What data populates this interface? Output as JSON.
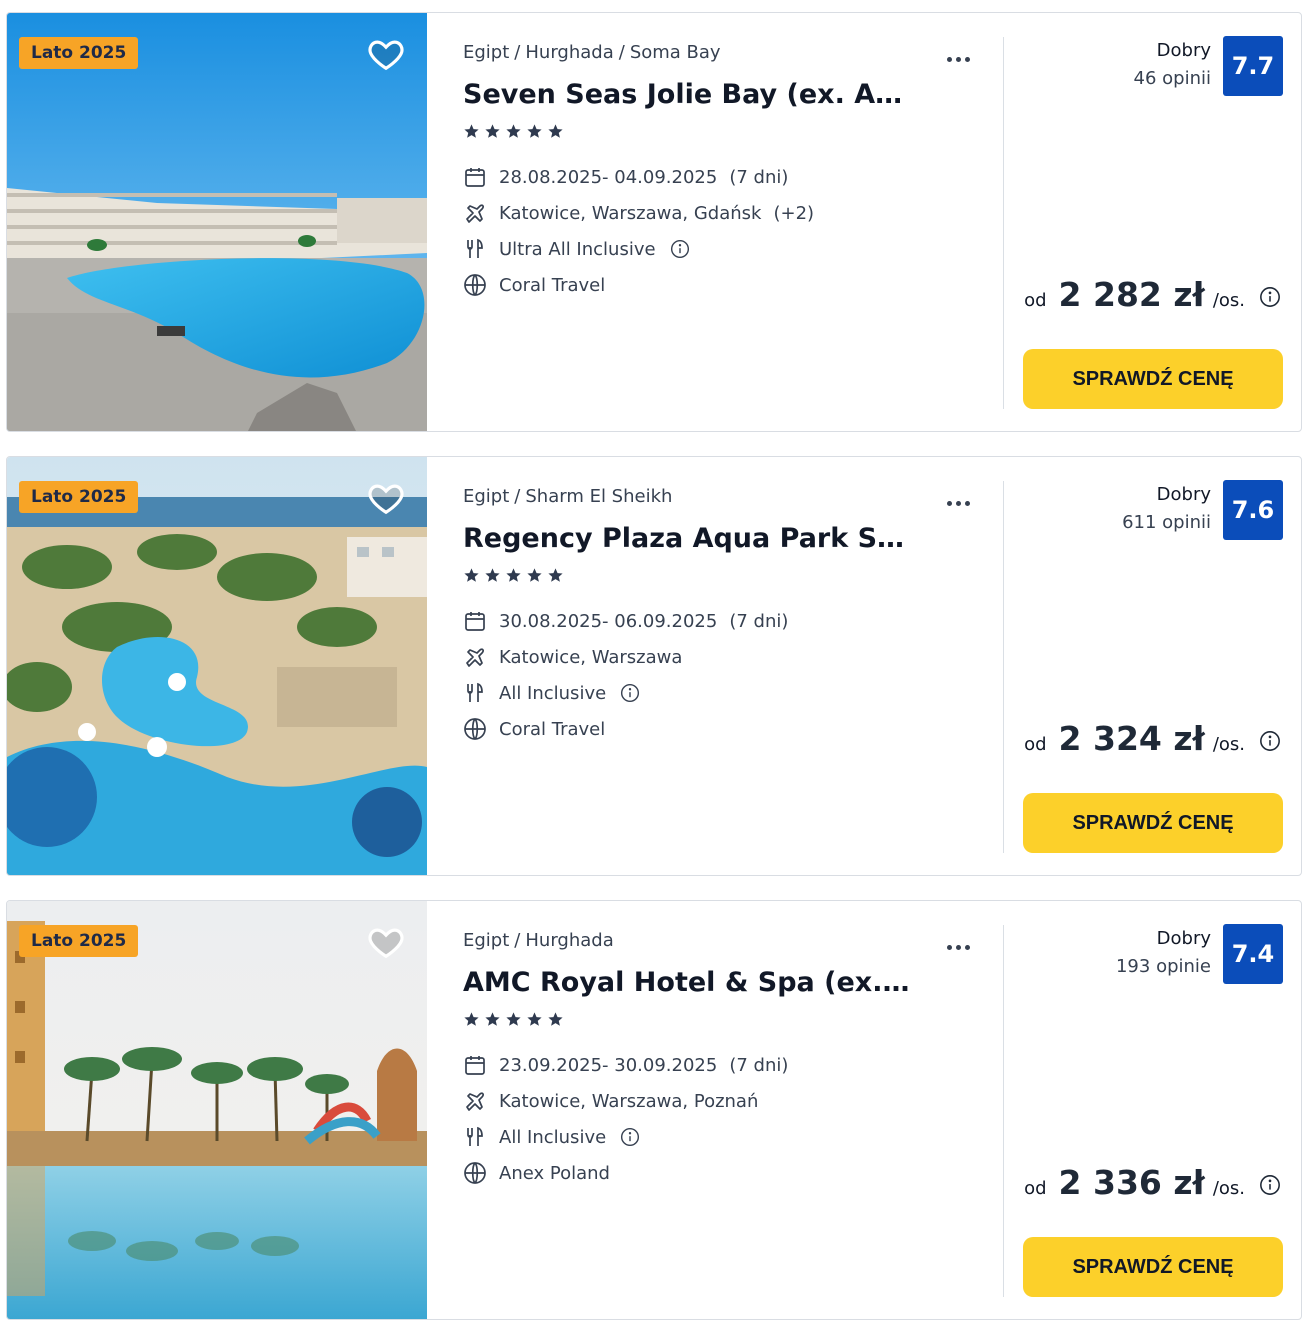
{
  "offers": [
    {
      "season_badge": "Lato 2025",
      "breadcrumb": [
        "Egipt",
        "Hurghada",
        "Soma Bay"
      ],
      "hotel_name": "Seven Seas Jolie Bay (ex. Aqua...",
      "stars": 5,
      "dates": "28.08.2025- 04.09.2025",
      "duration": "(7 dni)",
      "departures": "Katowice, Warszawa, Gdańsk",
      "departures_extra": "(+2)",
      "board": "Ultra All Inclusive",
      "operator": "Coral Travel",
      "rating_label": "Dobry",
      "reviews": "46 opinii",
      "score": "7.7",
      "price_prefix": "od",
      "price": "2 282 zł",
      "price_suffix": "/os.",
      "cta_label": "SPRAWDŹ CENĘ"
    },
    {
      "season_badge": "Lato 2025",
      "breadcrumb": [
        "Egipt",
        "Sharm El Sheikh"
      ],
      "hotel_name": "Regency Plaza Aqua Park Spa",
      "stars": 5,
      "dates": "30.08.2025- 06.09.2025",
      "duration": "(7 dni)",
      "departures": "Katowice, Warszawa",
      "departures_extra": "",
      "board": "All Inclusive",
      "operator": "Coral Travel",
      "rating_label": "Dobry",
      "reviews": "611 opinii",
      "score": "7.6",
      "price_prefix": "od",
      "price": "2 324 zł",
      "price_suffix": "/os.",
      "cta_label": "SPRAWDŹ CENĘ"
    },
    {
      "season_badge": "Lato 2025",
      "breadcrumb": [
        "Egipt",
        "Hurghada"
      ],
      "hotel_name": "AMC Royal Hotel & Spa (ex. AM...",
      "stars": 5,
      "dates": "23.09.2025- 30.09.2025",
      "duration": "(7 dni)",
      "departures": "Katowice, Warszawa, Poznań",
      "departures_extra": "",
      "board": "All Inclusive",
      "operator": "Anex Poland",
      "rating_label": "Dobry",
      "reviews": "193 opinie",
      "score": "7.4",
      "price_prefix": "od",
      "price": "2 336 zł",
      "price_suffix": "/os.",
      "cta_label": "SPRAWDŹ CENĘ"
    }
  ],
  "icons": {
    "favorite": "heart-icon",
    "more": "more-dots-icon",
    "dates": "calendar-icon",
    "departures": "plane-icon",
    "board": "cutlery-icon",
    "operator": "globe-icon",
    "info": "info-icon",
    "rating": "star-icon"
  },
  "colors": {
    "season_badge": "#f7a426",
    "score_badge": "#0b4dba",
    "cta_button": "#fcd02a",
    "stars": "#2f3a4f"
  }
}
